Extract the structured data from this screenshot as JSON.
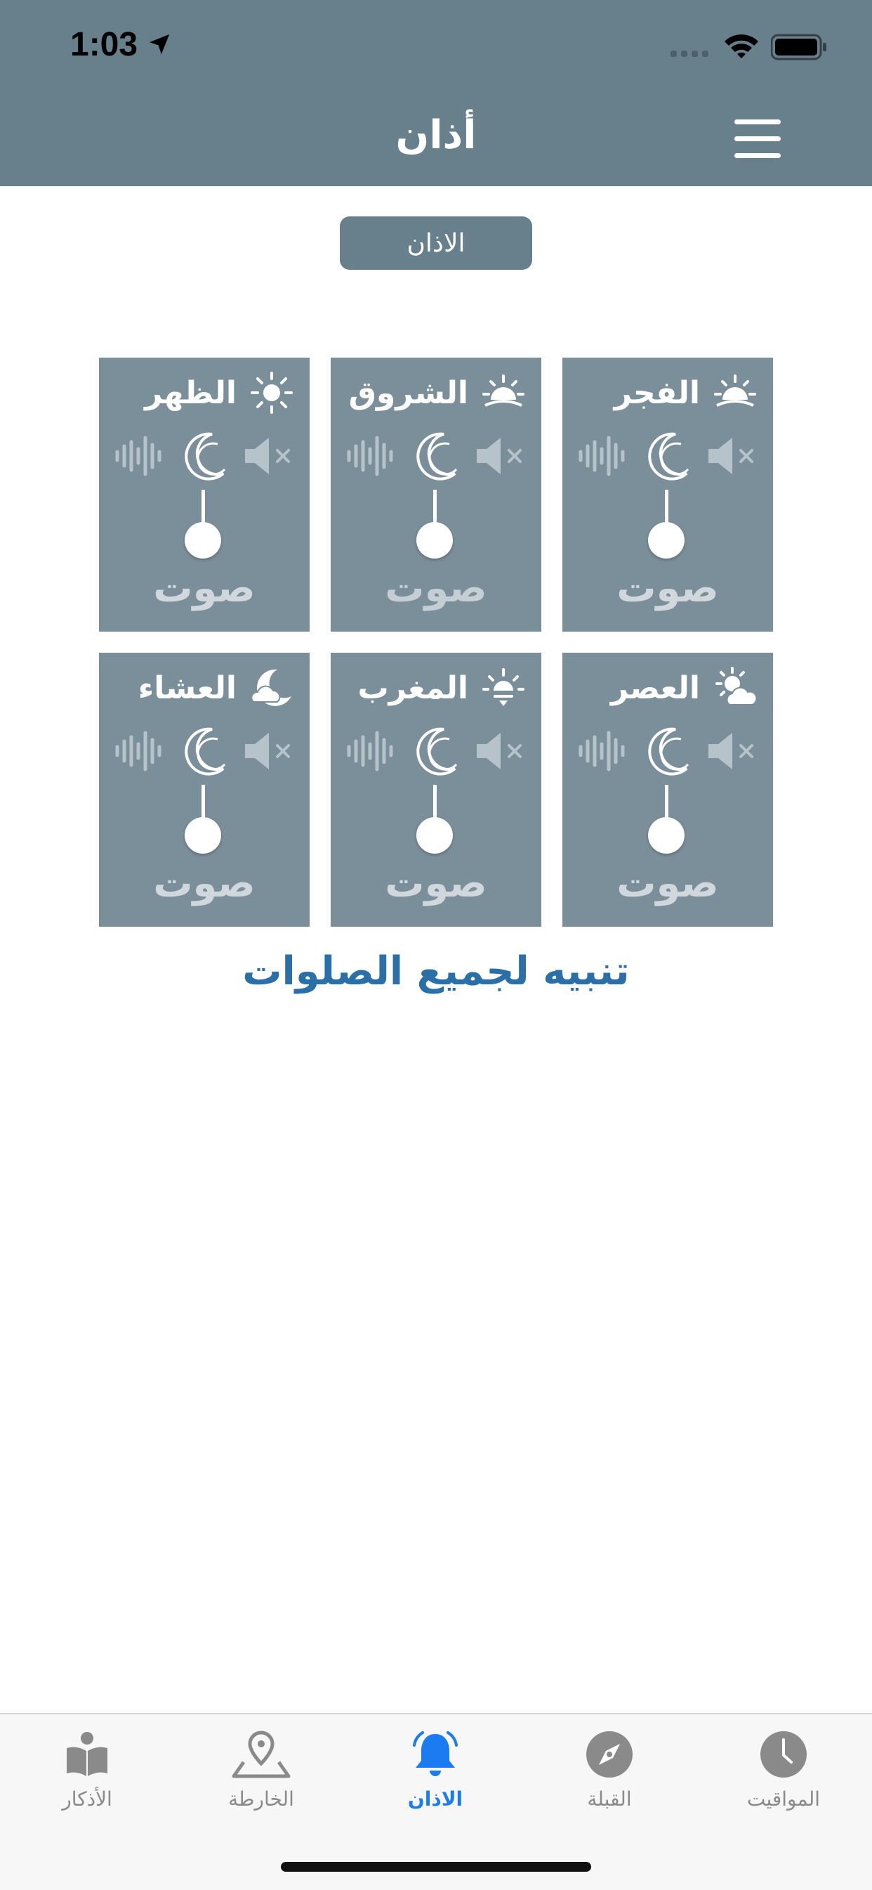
{
  "status": {
    "time": "1:03"
  },
  "header": {
    "title": "أذان"
  },
  "section_button": "الاذان",
  "mode_label": "صوت",
  "prayers": [
    {
      "name": "الفجر",
      "icon": "sunrise-icon"
    },
    {
      "name": "الشروق",
      "icon": "sunrise-icon"
    },
    {
      "name": "الظهر",
      "icon": "sun-icon"
    },
    {
      "name": "العصر",
      "icon": "sun-cloud-icon"
    },
    {
      "name": "المغرب",
      "icon": "sunset-icon"
    },
    {
      "name": "العشاء",
      "icon": "moon-cloud-icon"
    }
  ],
  "all_prayers_link": "تنبيه لجميع الصلوات",
  "tabs": [
    {
      "label": "المواقيت",
      "icon": "clock-icon"
    },
    {
      "label": "القبلة",
      "icon": "compass-icon"
    },
    {
      "label": "الاذان",
      "icon": "bell-icon",
      "active": true
    },
    {
      "label": "الخارطة",
      "icon": "map-pin-icon"
    },
    {
      "label": "الأذكار",
      "icon": "book-icon"
    }
  ],
  "colors": {
    "header": "#687f8c",
    "card": "#7b8f9b",
    "accent": "#2a6fa8",
    "tab_active": "#1a7cf0"
  }
}
